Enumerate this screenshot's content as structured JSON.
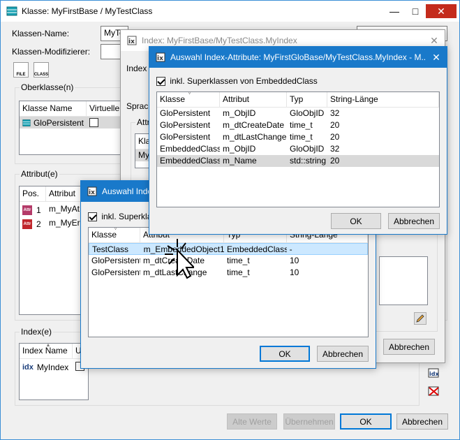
{
  "main": {
    "title": "Klasse: MyFirstBase / MyTestClass",
    "klassen_name_label": "Klassen-Name:",
    "klassen_name_value": "MyTe",
    "modifizierer_label": "Klassen-Modifizierer:",
    "file_icon_text": "FILE",
    "class_icon_text": "CLASS",
    "oberklasse_title": "Oberklasse(n)",
    "oberklasse_cols": [
      "Klasse Name",
      "Virtuelle"
    ],
    "oberklasse_rows": [
      {
        "name": "GloPersistent"
      }
    ],
    "attribut_title": "Attribut(e)",
    "attribut_cols": [
      "Pos.",
      "Attribut"
    ],
    "attribut_rows": [
      {
        "pos": "1",
        "name": "m_MyAt"
      },
      {
        "pos": "2",
        "name": "m_MyEr"
      }
    ],
    "attr_icon_text": "Attr",
    "index_title": "Index(e)",
    "index_cols": [
      "Index Name",
      "U"
    ],
    "index_rows": [
      {
        "icon": "idx",
        "name": "MyIndex"
      }
    ],
    "buttons": {
      "alte_werte": "Alte Werte",
      "uebernehmen": "Übernehmen",
      "ok": "OK",
      "abbrechen": "Abbrechen"
    }
  },
  "index_dialog": {
    "title": "Index: MyFirstBase/MyTestClass.MyIndex",
    "index_label": "Index",
    "sprach_label": "Sprach",
    "attr_label": "Attri",
    "list_head": "Kla",
    "list_row": "My",
    "abbrechen": "Abbrechen"
  },
  "auswahl_front": {
    "title": "Auswahl Index-Attribute: MyFirstGloBase/MyTestClass.MyIndex - M...",
    "checkbox_label": "inkl. Superklassen von EmbeddedClass",
    "columns": [
      "Klasse",
      "Attribut",
      "Typ",
      "String-Länge"
    ],
    "rows": [
      [
        "GloPersistent",
        "m_ObjID",
        "GloObjID",
        "32"
      ],
      [
        "GloPersistent",
        "m_dtCreateDate",
        "time_t",
        "20"
      ],
      [
        "GloPersistent",
        "m_dtLastChange",
        "time_t",
        "20"
      ],
      [
        "EmbeddedClass",
        "m_ObjID",
        "GloObjID",
        "32"
      ],
      [
        "EmbeddedClass",
        "m_Name",
        "std::string",
        "20"
      ]
    ],
    "ok": "OK",
    "abbrechen": "Abbrechen"
  },
  "auswahl_back": {
    "title": "Auswahl Inde",
    "checkbox_label": "inkl. Superklas",
    "columns": [
      "Klasse",
      "Attribut",
      "Typ",
      "String-Länge"
    ],
    "rows": [
      [
        "TestClass",
        "m_EmbeddedObject1",
        "EmbeddedClass",
        "-"
      ],
      [
        "GloPersistent",
        "m_dtCreateDate",
        "time_t",
        "10"
      ],
      [
        "GloPersistent",
        "m_dtLastChange",
        "time_t",
        "10"
      ]
    ],
    "ok": "OK",
    "abbrechen": "Abbrechen"
  },
  "colors": {
    "titlebar_active": "#1979ca",
    "close_red": "#c42b1c",
    "selection_blue": "#cce8ff",
    "default_button_border": "#0078d7"
  }
}
